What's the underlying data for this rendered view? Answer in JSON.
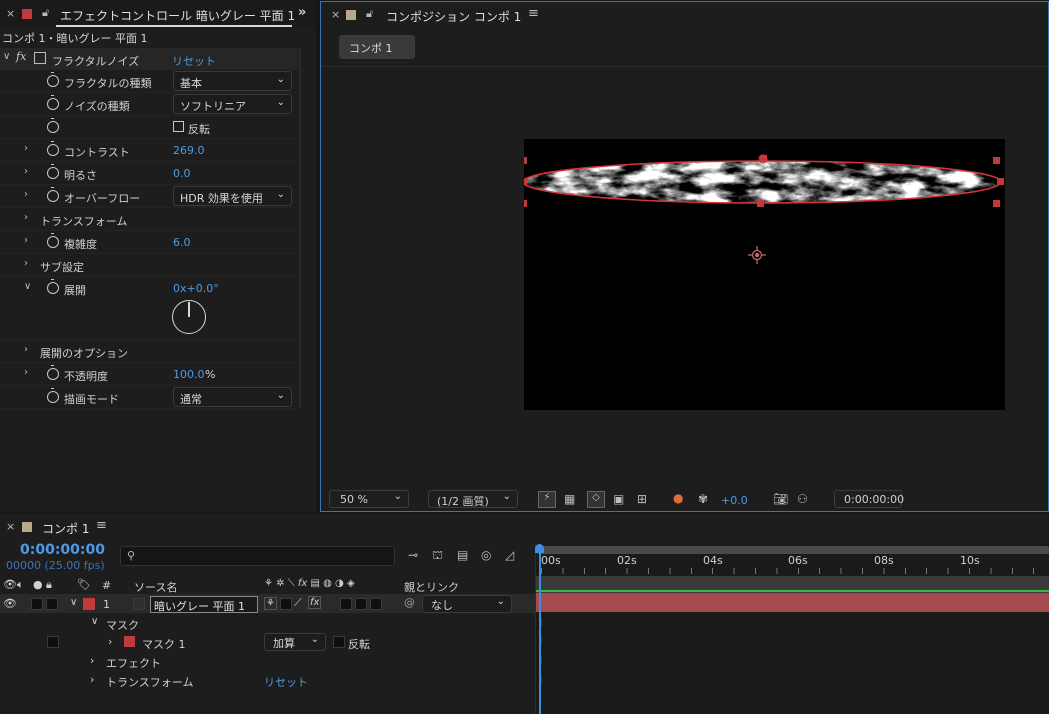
{
  "effect_panel": {
    "title": "エフェクトコントロール 暗いグレー 平面 1",
    "breadcrumb": "コンポ 1・暗いグレー 平面 1",
    "effect_name": "フラクタルノイズ",
    "reset": "リセット",
    "fractal_type_label": "フラクタルの種類",
    "fractal_type_value": "基本",
    "noise_type_label": "ノイズの種類",
    "noise_type_value": "ソフトリニア",
    "invert_label": "反転",
    "contrast_label": "コントラスト",
    "contrast_value": "269.0",
    "brightness_label": "明るさ",
    "brightness_value": "0.0",
    "overflow_label": "オーバーフロー",
    "overflow_value": "HDR 効果を使用",
    "transform_label": "トランスフォーム",
    "complexity_label": "複雑度",
    "complexity_value": "6.0",
    "sub_settings_label": "サブ設定",
    "evolution_label": "展開",
    "evolution_value": "0x+0.0°",
    "evolution_options_label": "展開のオプション",
    "opacity_label": "不透明度",
    "opacity_value": "100.0",
    "opacity_unit": "%",
    "blend_mode_label": "描画モード",
    "blend_mode_value": "通常"
  },
  "comp_panel": {
    "title": "コンポジション コンポ 1",
    "tab": "コンポ 1",
    "zoom": "50 %",
    "resolution": "(1/2 画質)",
    "exposure": "+0.0",
    "timecode": "0:00:00:00"
  },
  "timeline": {
    "title": "コンポ 1",
    "timecode": "0:00:00:00",
    "frame_info": "00000 (25.00 fps)",
    "search_placeholder": "",
    "col_hash": "#",
    "col_source": "ソース名",
    "col_parent": "親とリンク",
    "layer_number": "1",
    "layer_name": "暗いグレー 平面 1",
    "parent_value": "なし",
    "mask_group": "マスク",
    "mask_name": "マスク 1",
    "mask_mode": "加算",
    "mask_invert": "反転",
    "effects_group": "エフェクト",
    "transform_group": "トランスフォーム",
    "transform_reset": "リセット",
    "ruler": [
      "00s",
      "02s",
      "04s",
      "06s",
      "08s",
      "10s"
    ]
  },
  "colors": {
    "accent": "#4d9be8",
    "layer_label": "#c0393b",
    "layer_bar": "#a84a4d",
    "panel_bg": "#1d1d1d",
    "canvas_bg": "#000000"
  }
}
